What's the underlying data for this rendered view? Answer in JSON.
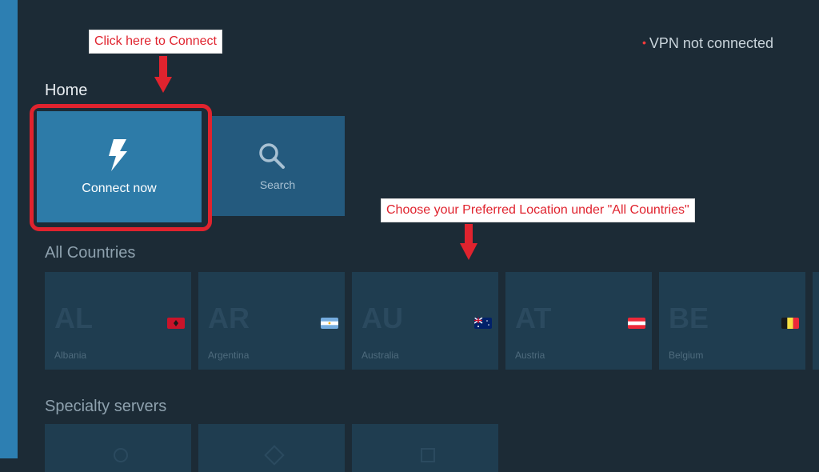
{
  "status": {
    "text": "VPN not connected",
    "dot": "•"
  },
  "home": {
    "title": "Home",
    "tiles": [
      {
        "label": "Connect now",
        "icon": "lightning-bolt-icon"
      },
      {
        "label": "Search",
        "icon": "search-icon"
      }
    ]
  },
  "all_countries": {
    "title": "All Countries",
    "items": [
      {
        "code": "AL",
        "name": "Albania",
        "flag": "albania-flag-icon"
      },
      {
        "code": "AR",
        "name": "Argentina",
        "flag": "argentina-flag-icon"
      },
      {
        "code": "AU",
        "name": "Australia",
        "flag": "australia-flag-icon"
      },
      {
        "code": "AT",
        "name": "Austria",
        "flag": "austria-flag-icon"
      },
      {
        "code": "BE",
        "name": "Belgium",
        "flag": "belgium-flag-icon"
      }
    ]
  },
  "specialty": {
    "title": "Specialty servers"
  },
  "annotations": {
    "connect_note": "Click here to Connect",
    "countries_note": "Choose your Preferred Location under \"All Countries\""
  },
  "colors": {
    "background": "#1c2b36",
    "accent": "#2d7fb2",
    "tile_primary": "#2d7ba8",
    "highlight": "#e0232e",
    "status_dot": "#ff3b3b"
  }
}
